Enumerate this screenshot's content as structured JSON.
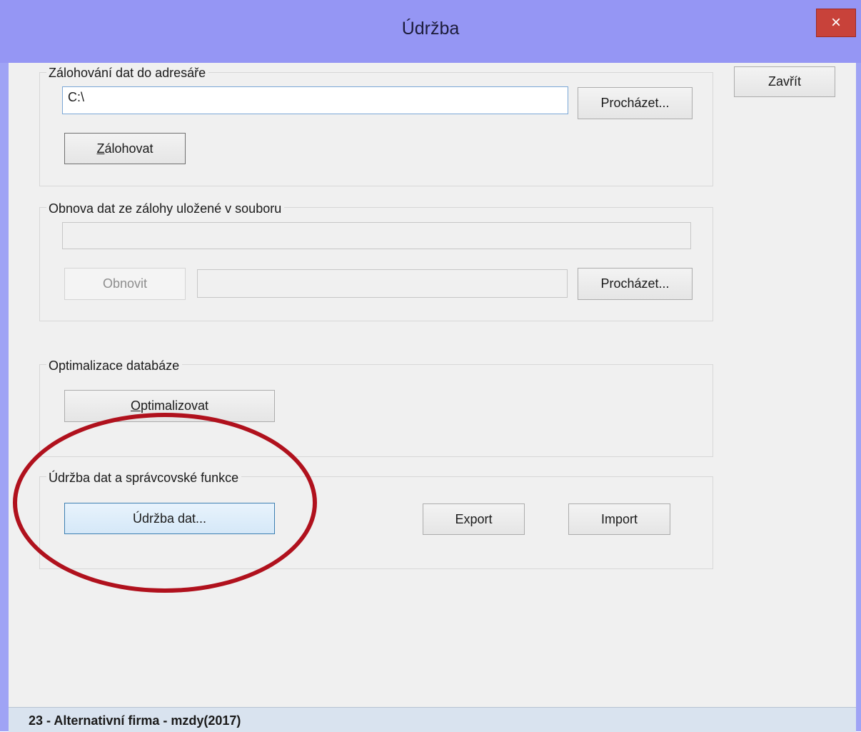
{
  "window": {
    "title": "Údržba"
  },
  "buttons": {
    "close_symbol": "×",
    "zavrit": "Zavřít"
  },
  "backup": {
    "legend": "Zálohování dat do adresáře",
    "path_value": "C:\\",
    "browse_label": "Procházet...",
    "backup_label_u": "Z",
    "backup_label_rest": "álohovat"
  },
  "restore": {
    "legend": "Obnova dat ze zálohy uložené v souboru",
    "file_value": "",
    "restore_label": "Obnovit",
    "browse_label": "Procházet..."
  },
  "optimize": {
    "legend": "Optimalizace databáze",
    "optimize_label_u": "O",
    "optimize_label_rest": "ptimalizovat"
  },
  "admin": {
    "legend": "Údržba dat a správcovské funkce",
    "maintenance_label": "Údržba dat...",
    "export_label": "Export",
    "import_label": "Import"
  },
  "status_bar": {
    "text": "23 - Alternativní firma - mzdy(2017)"
  },
  "colors": {
    "titlebar": "#9596f4",
    "close_button": "#c8423a",
    "highlight_ring": "#b0111d"
  }
}
